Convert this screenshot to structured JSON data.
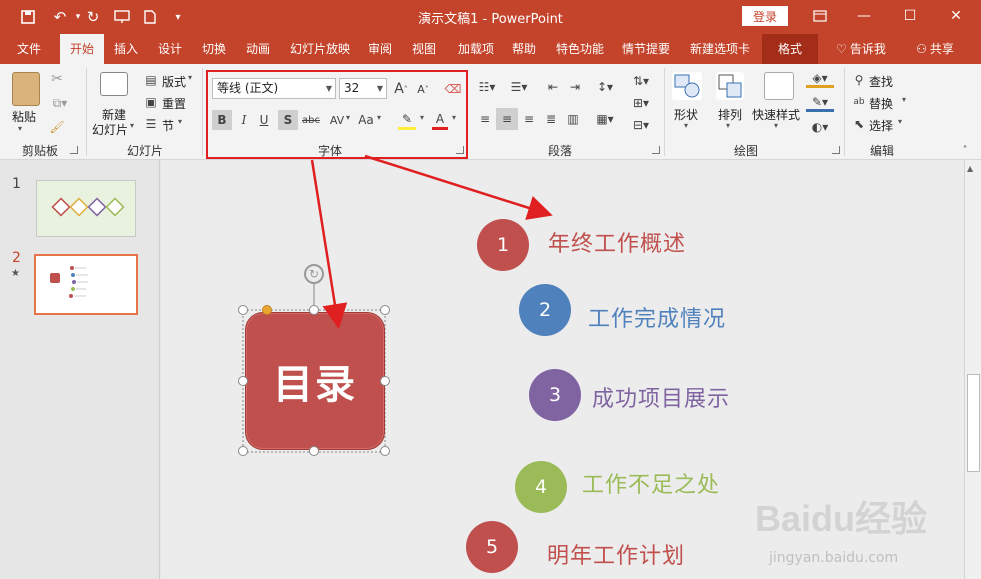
{
  "titlebar": {
    "title": "演示文稿1  -  PowerPoint",
    "login": "登录",
    "icons": [
      "save-icon",
      "undo-icon",
      "redo-icon",
      "present-icon",
      "new-icon",
      "customize-icon"
    ]
  },
  "tabs": [
    {
      "label": "文件"
    },
    {
      "label": "开始"
    },
    {
      "label": "插入"
    },
    {
      "label": "设计"
    },
    {
      "label": "切换"
    },
    {
      "label": "动画"
    },
    {
      "label": "幻灯片放映"
    },
    {
      "label": "审阅"
    },
    {
      "label": "视图"
    },
    {
      "label": "加载项"
    },
    {
      "label": "帮助"
    },
    {
      "label": "特色功能"
    },
    {
      "label": "情节提要"
    },
    {
      "label": "新建选项卡"
    },
    {
      "label": "格式"
    },
    {
      "label": "告诉我"
    },
    {
      "label": "共享"
    }
  ],
  "ribbon": {
    "clipboard": {
      "paste": "粘贴",
      "label": "剪贴板"
    },
    "slides": {
      "new_slide_line1": "新建",
      "new_slide_line2": "幻灯片",
      "layout": "版式",
      "reset": "重置",
      "section": "节",
      "label": "幻灯片"
    },
    "font": {
      "font_name": "等线 (正文)",
      "font_size": "32",
      "bold": "B",
      "italic": "I",
      "underline": "U",
      "shadow": "S",
      "strike": "abc",
      "char_spacing": "AV",
      "case": "Aa",
      "font_color": "A",
      "grow": "A",
      "shrink": "A",
      "label": "字体"
    },
    "paragraph": {
      "label": "段落"
    },
    "drawing": {
      "shapes": "形状",
      "arrange": "排列",
      "quick_styles": "快速样式",
      "label": "绘图"
    },
    "editing": {
      "find": "查找",
      "replace": "替换",
      "select": "选择",
      "label": "编辑"
    }
  },
  "thumbnails": [
    {
      "number": "1"
    },
    {
      "number": "2",
      "star": "★"
    }
  ],
  "slide": {
    "title_box": "目录",
    "items": [
      {
        "num": "1",
        "text": "年终工作概述",
        "color": "#c0504d"
      },
      {
        "num": "2",
        "text": "工作完成情况",
        "color": "#4f81bd"
      },
      {
        "num": "3",
        "text": "成功项目展示",
        "color": "#8064a2"
      },
      {
        "num": "4",
        "text": "工作不足之处",
        "color": "#9bbb59"
      },
      {
        "num": "5",
        "text": "明年工作计划",
        "color": "#c0504d"
      }
    ]
  },
  "watermark": {
    "brand": "Baidu经验",
    "url": "jingyan.baidu.com"
  },
  "colors": {
    "accent": "#c4432b",
    "annotation": "#e02020"
  }
}
